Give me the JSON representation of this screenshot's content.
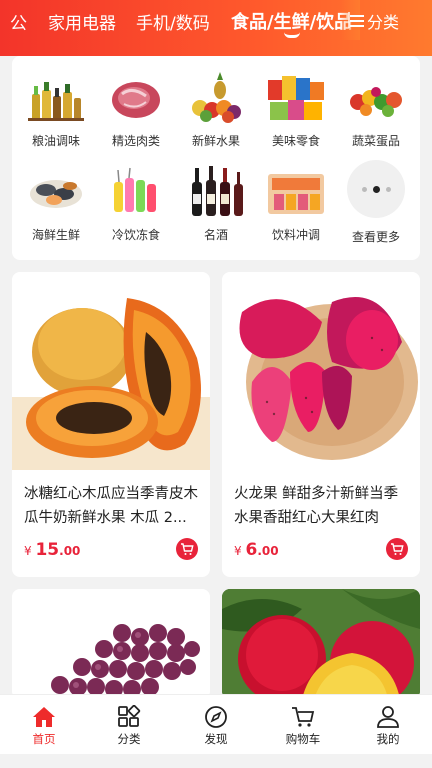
{
  "topbar": {
    "tabs": [
      {
        "label": "公",
        "active": false
      },
      {
        "label": "家用电器",
        "active": false
      },
      {
        "label": "手机/数码",
        "active": false
      },
      {
        "label": "食品/生鲜/饮品",
        "active": true
      }
    ],
    "category_button": "分类",
    "colors": {
      "gradient_start": "#f3342a",
      "gradient_end": "#ff7a2e"
    }
  },
  "categories": [
    {
      "label": "粮油调味",
      "icon": "oil-bottles"
    },
    {
      "label": "精选肉类",
      "icon": "meat"
    },
    {
      "label": "新鲜水果",
      "icon": "fruit-pile"
    },
    {
      "label": "美味零食",
      "icon": "snacks"
    },
    {
      "label": "蔬菜蛋品",
      "icon": "vegetables"
    },
    {
      "label": "海鲜生鲜",
      "icon": "seafood"
    },
    {
      "label": "冷饮冻食",
      "icon": "cold-drinks"
    },
    {
      "label": "名酒",
      "icon": "wine-bottles"
    },
    {
      "label": "饮料冲调",
      "icon": "drink-boxes"
    },
    {
      "label": "查看更多",
      "icon": "more-dots"
    }
  ],
  "products": [
    {
      "title": "冰糖红心木瓜应当季青皮木瓜牛奶新鲜水果 木瓜 2...",
      "currency": "¥",
      "price_int": "15",
      "price_dec": ".00",
      "image": "papaya"
    },
    {
      "title": "火龙果 鲜甜多汁新鲜当季水果香甜红心大果红肉 火...",
      "currency": "¥",
      "price_int": "6",
      "price_dec": ".00",
      "image": "dragon-fruit"
    },
    {
      "title": "",
      "image": "grapes"
    },
    {
      "title": "",
      "image": "nectarine"
    }
  ],
  "bottom_nav": [
    {
      "label": "首页",
      "icon": "home-icon",
      "active": true
    },
    {
      "label": "分类",
      "icon": "grid-icon",
      "active": false
    },
    {
      "label": "发现",
      "icon": "compass-icon",
      "active": false
    },
    {
      "label": "购物车",
      "icon": "cart-icon",
      "active": false
    },
    {
      "label": "我的",
      "icon": "user-icon",
      "active": false
    }
  ],
  "accent_color": "#e8233a"
}
